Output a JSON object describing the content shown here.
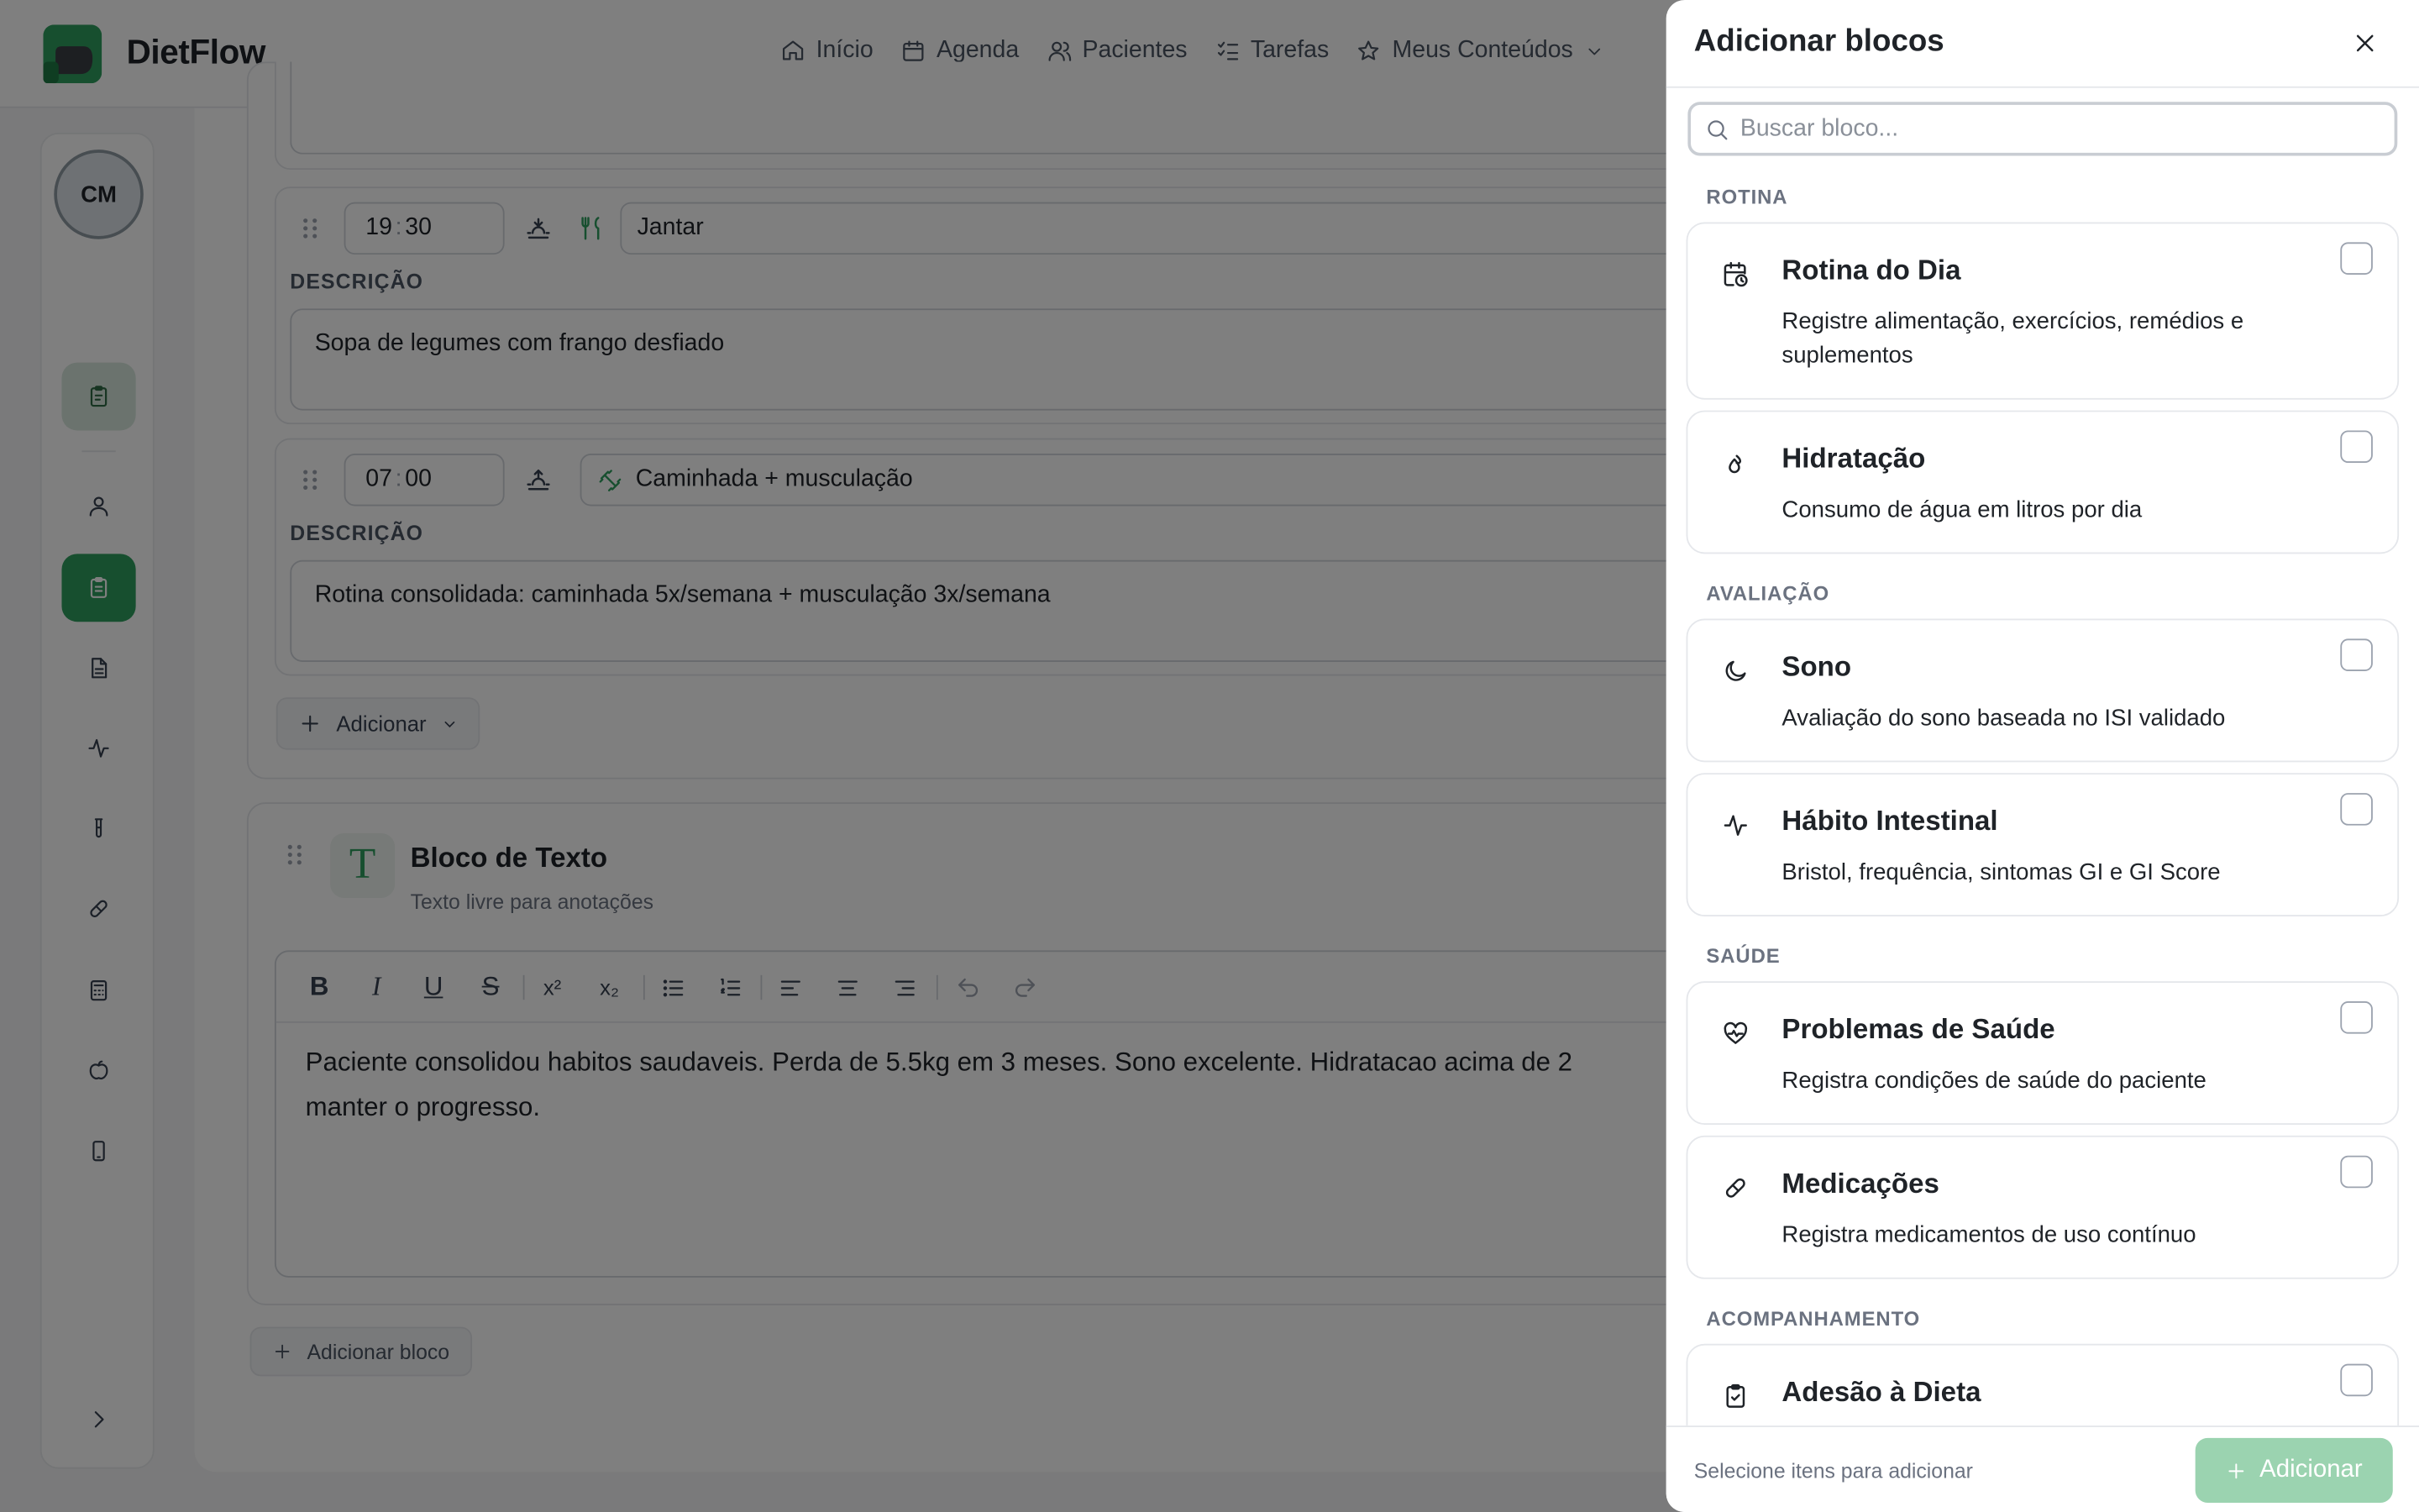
{
  "app": {
    "brand": "DietFlow"
  },
  "nav": {
    "items": [
      {
        "label": "Início",
        "icon": "home-icon"
      },
      {
        "label": "Agenda",
        "icon": "calendar-icon"
      },
      {
        "label": "Pacientes",
        "icon": "users-icon"
      },
      {
        "label": "Tarefas",
        "icon": "checklist-icon"
      },
      {
        "label": "Meus Conteúdos",
        "icon": "star-icon"
      }
    ]
  },
  "sidebar": {
    "avatar_initials": "CM"
  },
  "routine": {
    "rows": [
      {
        "time_h": "19",
        "time_m": "30",
        "activity": "Jantar",
        "description_label": "DESCRIÇÃO",
        "description": "Sopa de legumes com frango desfiado"
      },
      {
        "time_h": "07",
        "time_m": "00",
        "activity": "Caminhada + musculação",
        "description_label": "DESCRIÇÃO",
        "description": "Rotina consolidada: caminhada 5x/semana + musculação 3x/semana"
      }
    ],
    "add_label": "Adicionar"
  },
  "text_block": {
    "icon_letter": "T",
    "title": "Bloco de Texto",
    "subtitle": "Texto livre para anotações",
    "content_line1": "Paciente consolidou habitos saudaveis. Perda de 5.5kg em 3 meses. Sono excelente. Hidratacao acima de 2",
    "content_line2": "manter o progresso."
  },
  "add_block_label": "Adicionar bloco",
  "drawer": {
    "title": "Adicionar blocos",
    "search_placeholder": "Buscar bloco...",
    "sections": {
      "rotina": "ROTINA",
      "avaliacao": "AVALIAÇÃO",
      "saude": "SAÚDE",
      "acompanhamento": "ACOMPANHAMENTO"
    },
    "cards": [
      {
        "title": "Rotina do Dia",
        "desc": "Registre alimentação, exercícios, remédios e suplementos",
        "icon": "calendar-clock-icon"
      },
      {
        "title": "Hidratação",
        "desc": "Consumo de água em litros por dia",
        "icon": "droplets-icon"
      },
      {
        "title": "Sono",
        "desc": "Avaliação do sono baseada no ISI validado",
        "icon": "moon-icon"
      },
      {
        "title": "Hábito Intestinal",
        "desc": "Bristol, frequência, sintomas GI e GI Score",
        "icon": "activity-icon"
      },
      {
        "title": "Problemas de Saúde",
        "desc": "Registra condições de saúde do paciente",
        "icon": "heart-pulse-icon"
      },
      {
        "title": "Medicações",
        "desc": "Registra medicamentos de uso contínuo",
        "icon": "pill-icon"
      },
      {
        "title": "Adesão à Dieta",
        "desc": "",
        "icon": "clipboard-check-icon"
      }
    ],
    "footer_hint": "Selecione itens para adicionar",
    "footer_button": "Adicionar"
  },
  "colors": {
    "accent": "#2f9e5f",
    "accent_disabled": "#9bd3b0",
    "overlay": "rgba(0,0,0,0.5)"
  }
}
